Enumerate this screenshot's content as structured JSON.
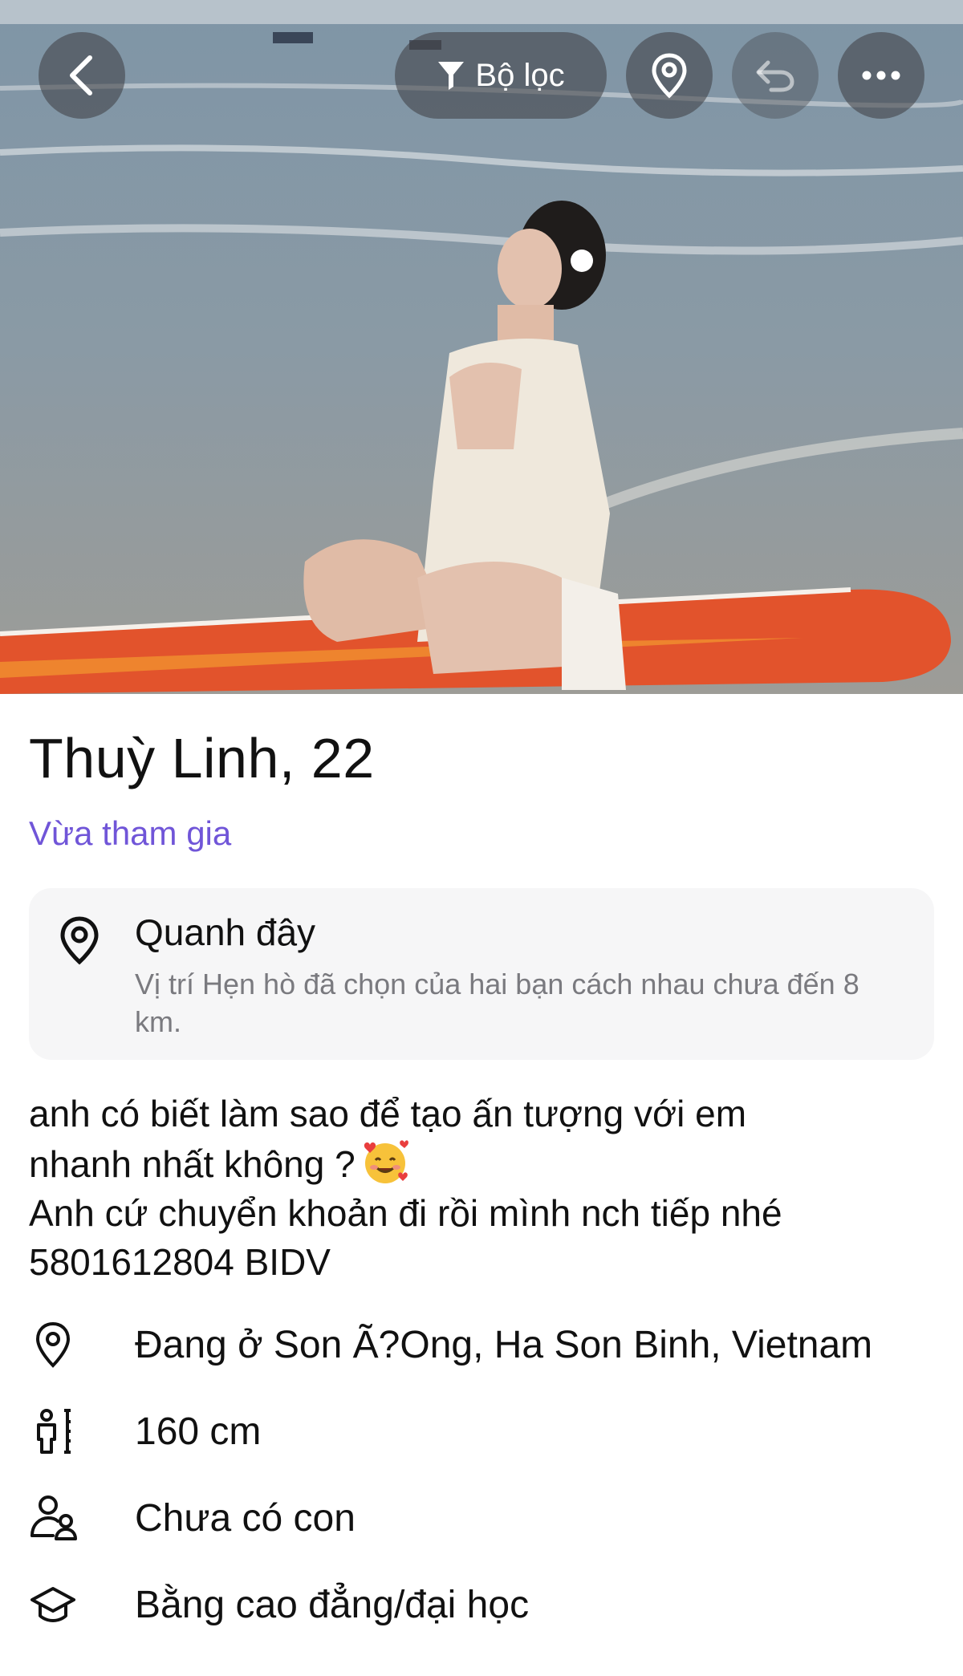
{
  "topbar": {
    "filter_label": "Bộ lọc"
  },
  "profile": {
    "name_age": "Thuỳ Linh, 22",
    "status": "Vừa tham gia"
  },
  "nearby": {
    "title": "Quanh đây",
    "description": "Vị trí Hẹn hò đã chọn của hai bạn cách nhau chưa đến 8 km."
  },
  "bio": {
    "line1": "anh có biết làm sao để tạo ấn tượng với em",
    "line2": "nhanh nhất không ?",
    "line3": "Anh cứ chuyển khoản đi rồi mình nch tiếp nhé",
    "line4": "5801612804 BIDV"
  },
  "details": {
    "location": "Đang ở Son Ã?Ong, Ha Son Binh, Vietnam",
    "height": "160 cm",
    "children": "Chưa có con",
    "education": "Bằng cao đẳng/đại học"
  },
  "colors": {
    "accent_purple": "#7055d8",
    "card_bg": "#f6f6f7",
    "muted_text": "#7a7a7f"
  },
  "icons": {
    "back": "chevron-left-icon",
    "filter": "filter-icon",
    "location": "location-pin-icon",
    "undo": "undo-icon",
    "more": "more-dots-icon",
    "height": "height-icon",
    "children": "person-child-icon",
    "education": "graduation-cap-icon"
  }
}
